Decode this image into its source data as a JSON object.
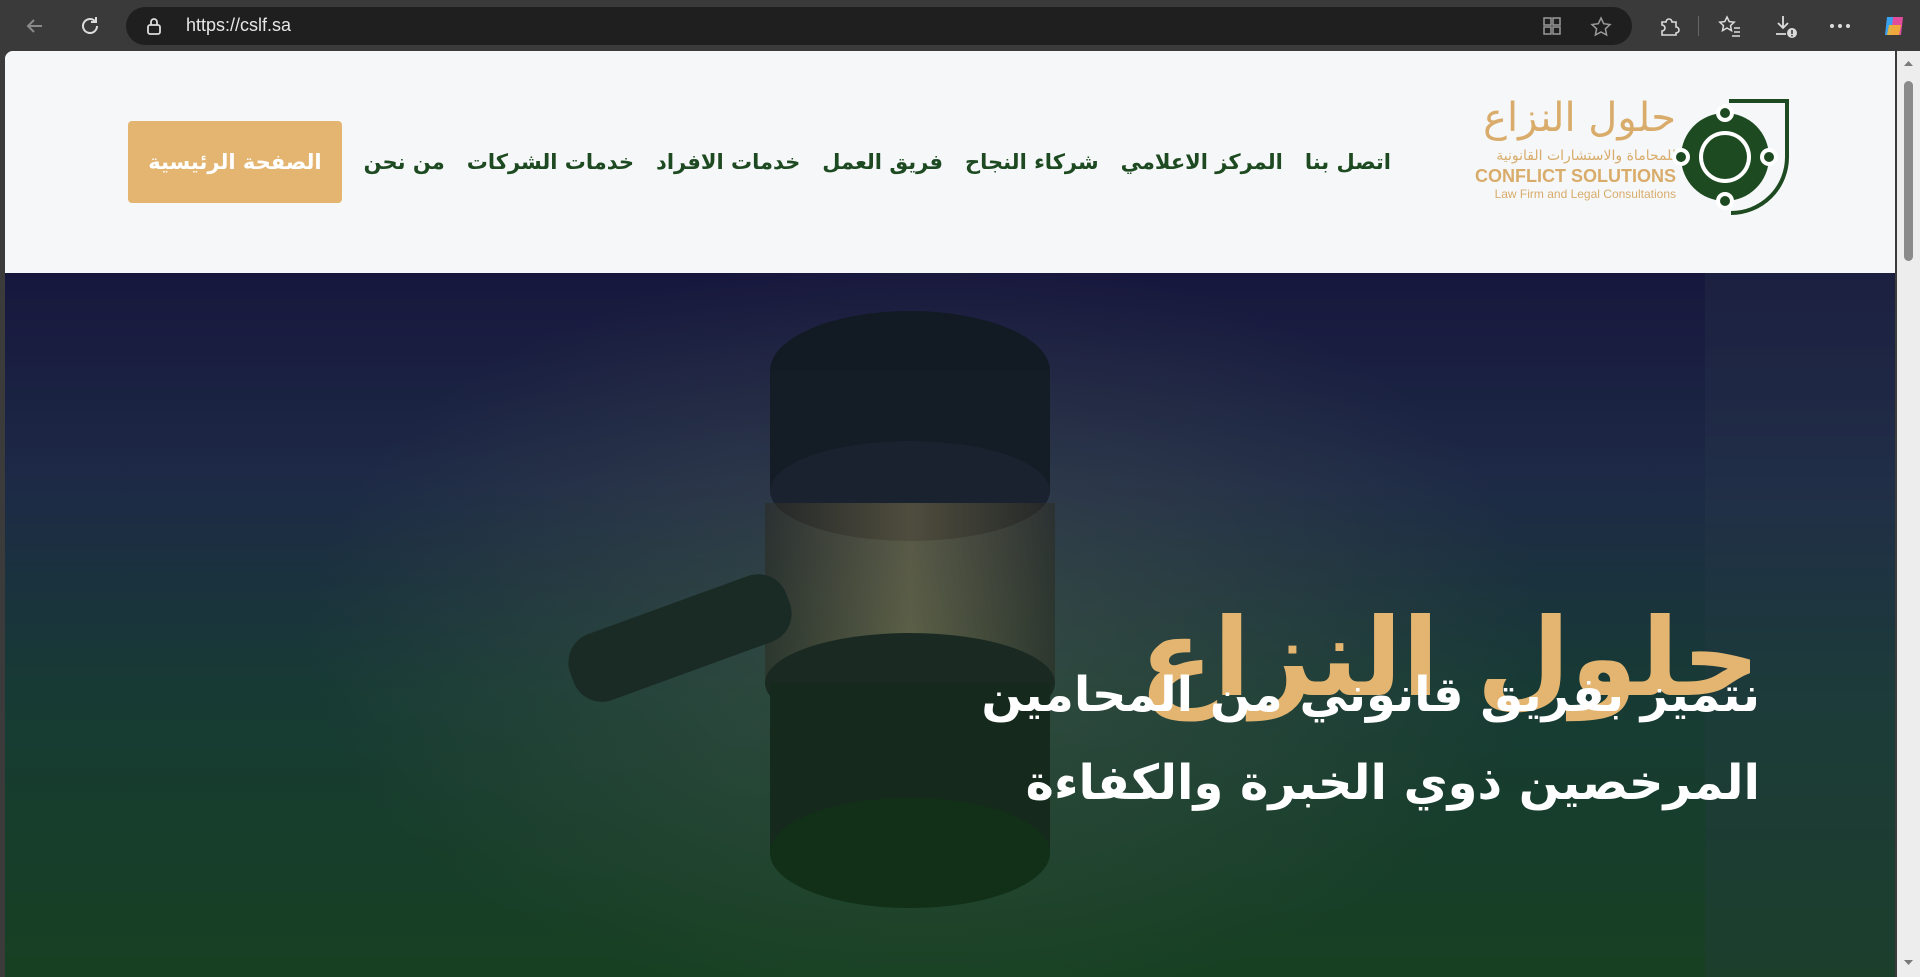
{
  "browser": {
    "url": "https://cslf.sa"
  },
  "site": {
    "logo": {
      "arabic_name": "حلول النزاع",
      "arabic_sub": "للمحاماة والاستشارات القانونية",
      "english_name": "CONFLICT SOLUTIONS",
      "english_sub": "Law Firm and Legal Consultations",
      "brand_green": "#1e4a22",
      "brand_gold": "#d9ac6b"
    },
    "nav": {
      "items": [
        {
          "label": "الصفحة الرئيسية",
          "active": true
        },
        {
          "label": "من نحن"
        },
        {
          "label": "خدمات الشركات"
        },
        {
          "label": "خدمات الافراد"
        },
        {
          "label": "فريق العمل"
        },
        {
          "label": "شركاء النجاح"
        },
        {
          "label": "المركز الاعلامي"
        },
        {
          "label": "اتصل بنا"
        }
      ]
    },
    "hero": {
      "title": "حلول النزاع",
      "line1": "نتميز بفريق قانوني من المحامين",
      "line2": "المرخصين ذوي الخبرة والكفاءة"
    }
  }
}
